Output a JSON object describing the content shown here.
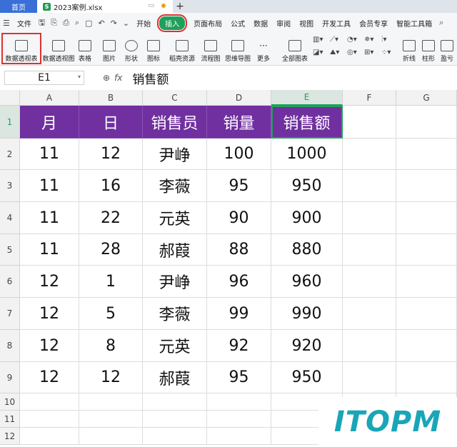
{
  "titlebar": {
    "home_tab": "首页",
    "file_tab": "2023案例.xlsx",
    "file_icon_letter": "S",
    "new_tab": "+"
  },
  "menubar": {
    "file_menu": "文件",
    "items": [
      "开始",
      "插入",
      "页面布局",
      "公式",
      "数据",
      "审阅",
      "视图",
      "开发工具",
      "会员专享",
      "智能工具箱"
    ],
    "active": "插入"
  },
  "ribbon": {
    "buttons": [
      "数据透视表",
      "数据透视图",
      "表格",
      "图片",
      "形状",
      "图标",
      "稻壳资源",
      "流程图",
      "思维导图",
      "更多",
      "全部图表",
      "折线",
      "柱形",
      "盈亏"
    ]
  },
  "formulabar": {
    "cell_ref": "E1",
    "fx_label": "fx",
    "value": "销售额"
  },
  "sheet": {
    "columns": [
      "A",
      "B",
      "C",
      "D",
      "E",
      "F",
      "G"
    ],
    "rows": [
      "1",
      "2",
      "3",
      "4",
      "5",
      "6",
      "7",
      "8",
      "9",
      "10",
      "11",
      "12"
    ],
    "header": [
      "月",
      "日",
      "销售员",
      "销量",
      "销售额"
    ],
    "data": [
      [
        "11",
        "12",
        "尹峥",
        "100",
        "1000"
      ],
      [
        "11",
        "16",
        "李薇",
        "95",
        "950"
      ],
      [
        "11",
        "22",
        "元英",
        "90",
        "900"
      ],
      [
        "11",
        "28",
        "郝葭",
        "88",
        "880"
      ],
      [
        "12",
        "1",
        "尹峥",
        "96",
        "960"
      ],
      [
        "12",
        "5",
        "李薇",
        "99",
        "990"
      ],
      [
        "12",
        "8",
        "元英",
        "92",
        "920"
      ],
      [
        "12",
        "12",
        "郝葭",
        "95",
        "950"
      ]
    ],
    "selected_cell": "E1",
    "header_fill_color": "#7030a0",
    "selection_color": "#1fa05a"
  },
  "watermark": "ITOPM"
}
